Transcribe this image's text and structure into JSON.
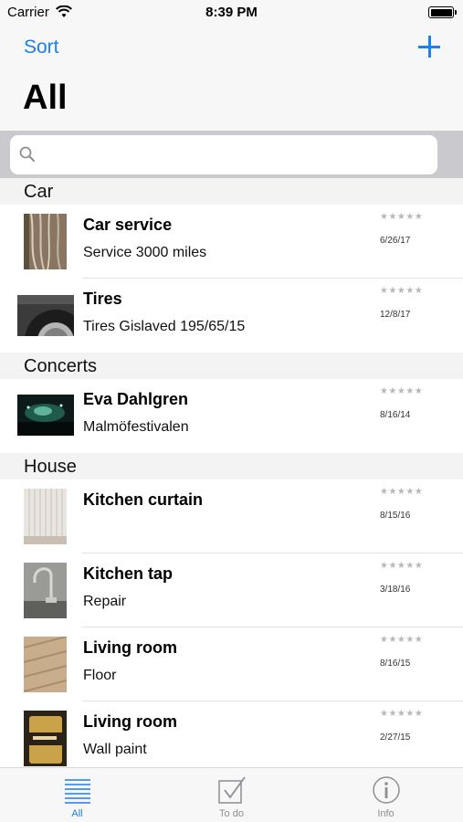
{
  "status_bar": {
    "carrier": "Carrier",
    "time": "8:39 PM"
  },
  "nav": {
    "sort_label": "Sort",
    "title": "All",
    "add_icon": "plus-icon"
  },
  "search": {
    "value": "",
    "placeholder": ""
  },
  "sections": [
    {
      "header": "Car",
      "items": [
        {
          "title": "Car service",
          "subtitle": "Service 3000 miles",
          "stars": "★★★★★",
          "date": "6/26/17",
          "thumb": "cables-photo"
        },
        {
          "title": "Tires",
          "subtitle": "Tires Gislaved 195/65/15",
          "stars": "★★★★★",
          "date": "12/8/17",
          "thumb": "tire-photo"
        }
      ]
    },
    {
      "header": "Concerts",
      "items": [
        {
          "title": "Eva Dahlgren",
          "subtitle": "Malmöfestivalen",
          "stars": "★★★★★",
          "date": "8/16/14",
          "thumb": "concert-photo"
        }
      ]
    },
    {
      "header": "House",
      "items": [
        {
          "title": "Kitchen curtain",
          "subtitle": "",
          "stars": "★★★★★",
          "date": "8/15/16",
          "thumb": "curtain-photo"
        },
        {
          "title": "Kitchen tap",
          "subtitle": "Repair",
          "stars": "★★★★★",
          "date": "3/18/16",
          "thumb": "tap-photo"
        },
        {
          "title": "Living room",
          "subtitle": "Floor",
          "stars": "★★★★★",
          "date": "8/16/15",
          "thumb": "floor-photo"
        },
        {
          "title": "Living room",
          "subtitle": "Wall paint",
          "stars": "★★★★★",
          "date": "2/27/15",
          "thumb": "paint-can-photo"
        }
      ]
    }
  ],
  "tabs": [
    {
      "label": "All",
      "icon": "list-icon",
      "active": true
    },
    {
      "label": "To do",
      "icon": "checkbox-icon",
      "active": false
    },
    {
      "label": "Info",
      "icon": "info-icon",
      "active": false
    }
  ],
  "colors": {
    "accent": "#1a7ff0",
    "section_bg": "#f3f3f3",
    "search_bg": "#c9c9ce",
    "bar_bg": "#f7f7f7"
  }
}
